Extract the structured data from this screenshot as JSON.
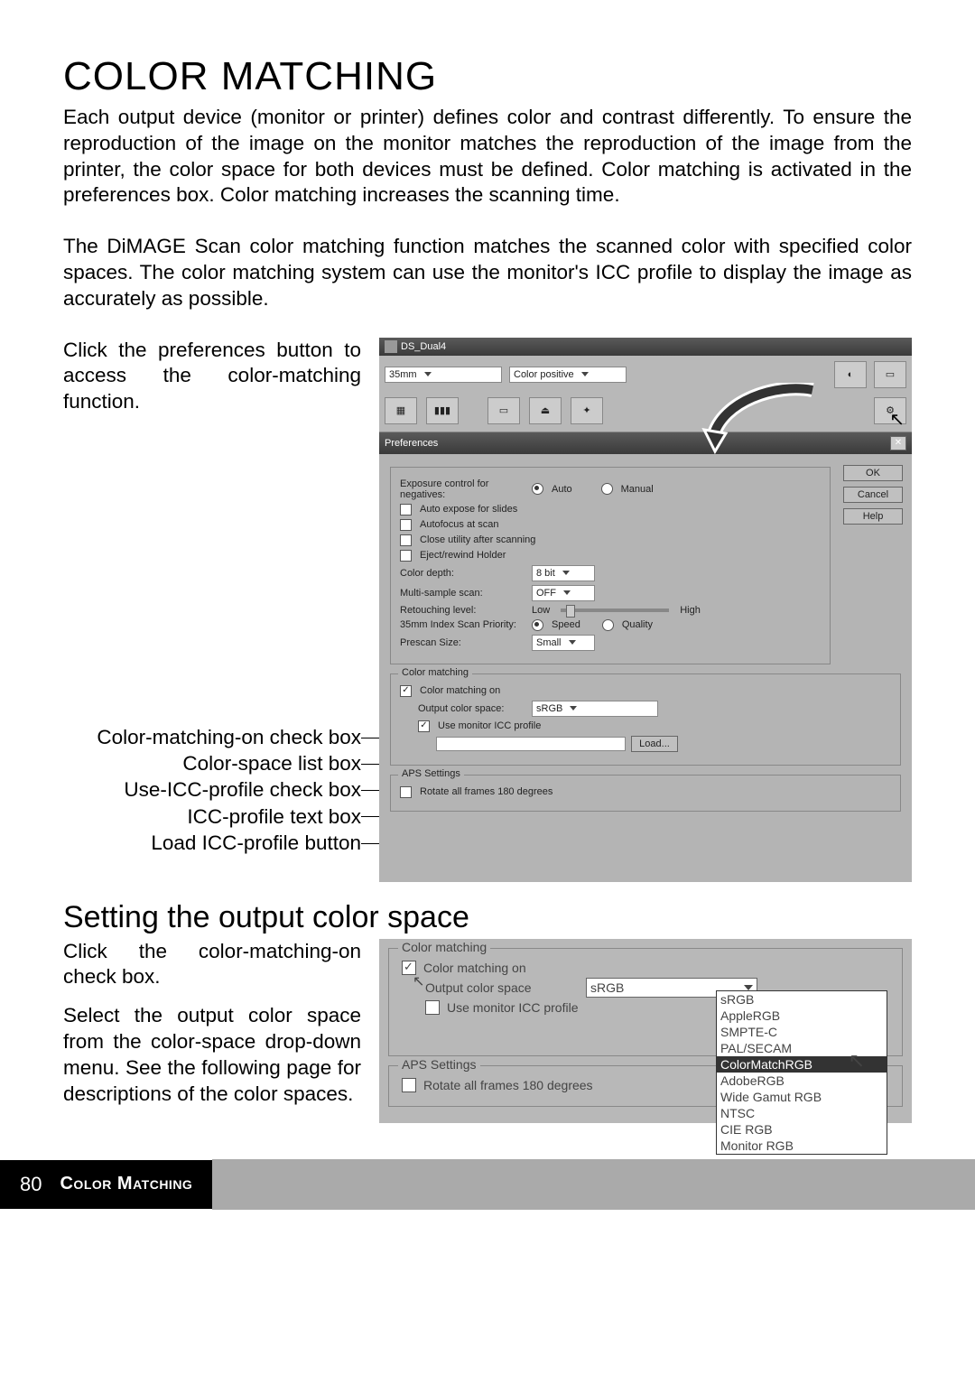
{
  "heading": "COLOR MATCHING",
  "para1": "Each output device (monitor or printer) defines color and contrast differently. To ensure the reproduction of the image on the monitor matches the reproduction of the image from the printer, the color space for both devices must be defined. Color matching is activated in the preferences box. Color matching increases the scanning time.",
  "para2": "The DiMAGE Scan color matching function matches the scanned color with specified color spaces. The color matching system can use the monitor's ICC profile to display the image as accurately as possible.",
  "instr1": "Click the preferences button to access the color-matching function.",
  "callouts": {
    "cm_on": "Color-matching-on check box",
    "cs_list": "Color-space list box",
    "icc_chk": "Use-ICC-profile check box",
    "icc_txt": "ICC-profile text box",
    "icc_btn": "Load ICC-profile button"
  },
  "fig1": {
    "title": "DS_Dual4",
    "film_type": "35mm",
    "film_polarity": "Color positive",
    "prefs_title": "Preferences",
    "buttons": {
      "ok": "OK",
      "cancel": "Cancel",
      "help": "Help"
    },
    "exposure_label": "Exposure control for negatives:",
    "auto": "Auto",
    "manual": "Manual",
    "auto_expose": "Auto expose for slides",
    "autofocus": "Autofocus at scan",
    "close_util": "Close utility after scanning",
    "eject_holder": "Eject/rewind Holder",
    "color_depth": "Color depth:",
    "color_depth_val": "8 bit",
    "multi_sample": "Multi-sample scan:",
    "multi_sample_val": "OFF",
    "retouch": "Retouching level:",
    "low": "Low",
    "high": "High",
    "index_priority": "35mm Index Scan Priority:",
    "speed": "Speed",
    "quality": "Quality",
    "prescan_size": "Prescan Size:",
    "prescan_val": "Small",
    "cm_group": "Color matching",
    "cm_on": "Color matching on",
    "output_cs": "Output color space:",
    "output_cs_val": "sRGB",
    "use_icc": "Use monitor ICC profile",
    "load": "Load...",
    "aps_group": "APS Settings",
    "rotate": "Rotate all frames 180 degrees"
  },
  "subheading": "Setting the output color space",
  "instr2a": "Click the color-matching-on check box.",
  "instr2b": "Select the output color space from the color-space drop-down menu. See the following page for descriptions of the color spaces.",
  "fig2": {
    "cm_group": "Color matching",
    "cm_on": "Color matching on",
    "output_cs": "Output color space",
    "output_cs_val": "sRGB",
    "use_icc": "Use monitor ICC profile",
    "aps_group": "APS Settings",
    "rotate": "Rotate all frames 180 degrees",
    "options": [
      "sRGB",
      "AppleRGB",
      "SMPTE-C",
      "PAL/SECAM",
      "ColorMatchRGB",
      "AdobeRGB",
      "Wide Gamut RGB",
      "NTSC",
      "CIE RGB",
      "Monitor RGB"
    ],
    "highlight_index": 4
  },
  "footer": {
    "page": "80",
    "section": "Color Matching"
  }
}
